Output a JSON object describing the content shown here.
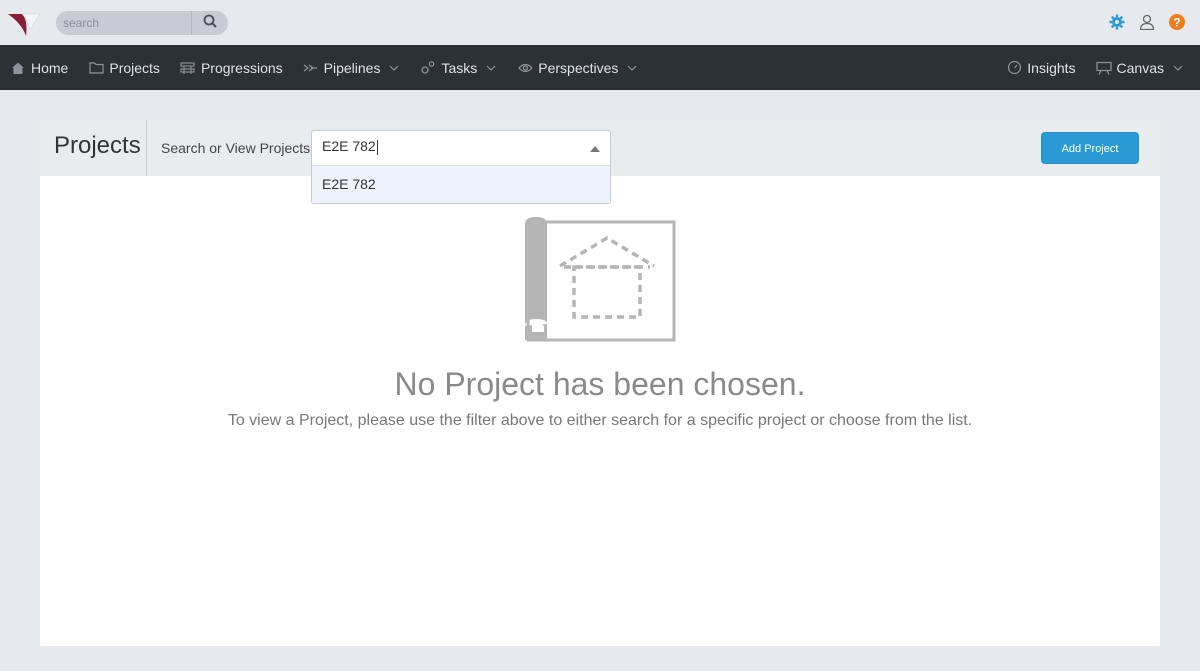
{
  "topbar": {
    "search_placeholder": "search",
    "icons": [
      "logo-icon",
      "search-icon",
      "gear-icon",
      "user-icon",
      "help-icon"
    ],
    "colors": {
      "gear": "#2b9ad4",
      "help": "#f07d1a",
      "logo": "#8a1c3c"
    }
  },
  "nav": {
    "left": [
      {
        "label": "Home",
        "icon": "home-icon"
      },
      {
        "label": "Projects",
        "icon": "folder-icon"
      },
      {
        "label": "Progressions",
        "icon": "progressions-icon"
      },
      {
        "label": "Pipelines",
        "icon": "pipelines-icon",
        "dropdown": true
      },
      {
        "label": "Tasks",
        "icon": "tasks-icon",
        "dropdown": true
      },
      {
        "label": "Perspectives",
        "icon": "eye-icon",
        "dropdown": true
      }
    ],
    "right": [
      {
        "label": "Insights",
        "icon": "gauge-icon"
      },
      {
        "label": "Canvas",
        "icon": "canvas-icon",
        "dropdown": true
      }
    ]
  },
  "panel": {
    "title": "Projects",
    "search_label": "Search or View Projects:",
    "select_value": "E2E 782",
    "dropdown_options": [
      "E2E 782"
    ],
    "add_button": "Add Project"
  },
  "empty_state": {
    "title": "No Project has been chosen.",
    "subtitle": "To view a Project, please use the filter above to either search for a specific project or choose from the list."
  }
}
